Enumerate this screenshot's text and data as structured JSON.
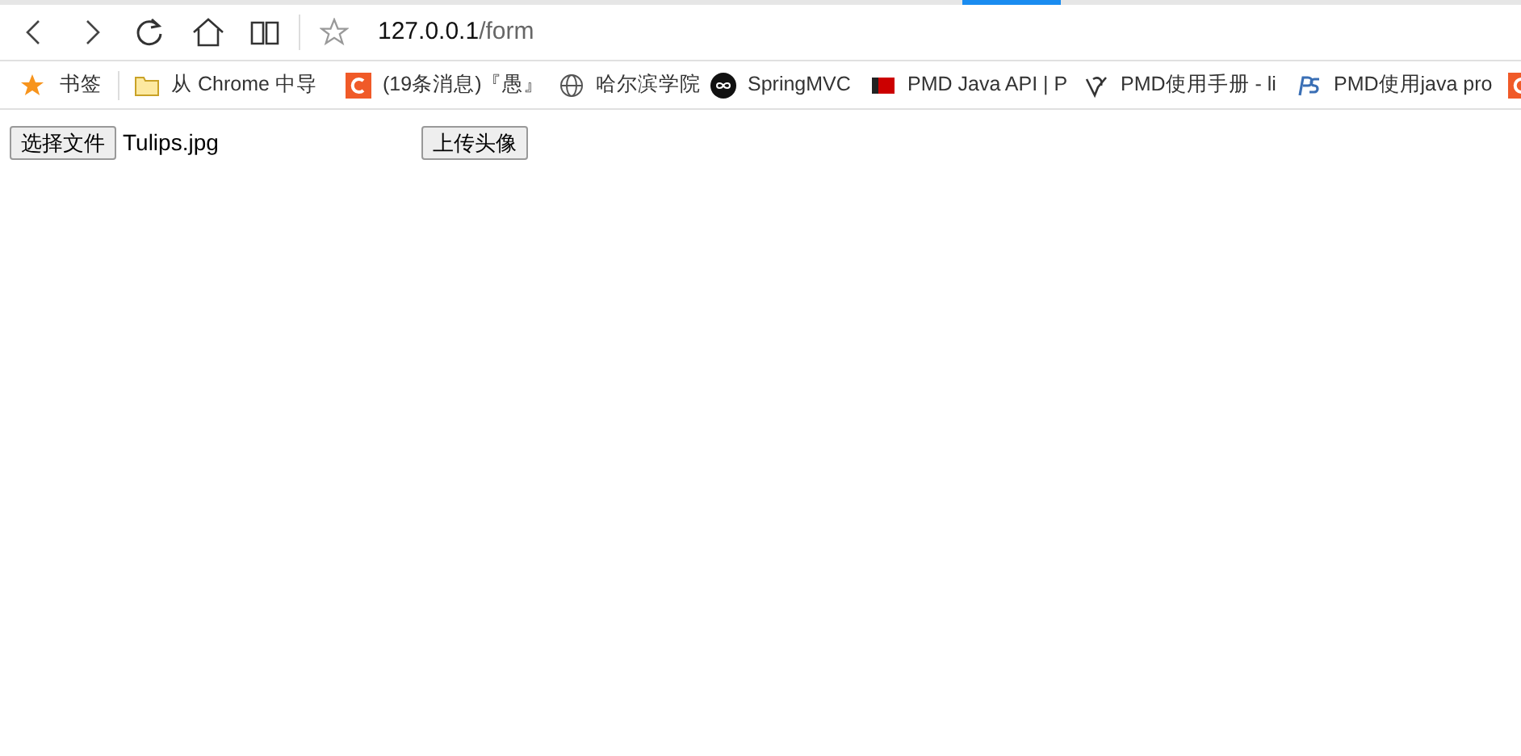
{
  "address_bar": {
    "host": "127.0.0.1",
    "path": "/form"
  },
  "bookmarks": [
    {
      "kind": "star",
      "label": "书签"
    },
    {
      "kind": "folder",
      "label": "从 Chrome 中导"
    },
    {
      "kind": "csdn",
      "label": "(19条消息)『愚』"
    },
    {
      "kind": "globe",
      "label": "哈尔滨学院"
    },
    {
      "kind": "infinity",
      "label": "SpringMVC"
    },
    {
      "kind": "pmd",
      "label": "PMD Java API | P"
    },
    {
      "kind": "sketch",
      "label": "PMD使用手册 - li"
    },
    {
      "kind": "ps",
      "label": "PMD使用java pro"
    },
    {
      "kind": "csdn"
    }
  ],
  "form": {
    "file_button": "选择文件",
    "file_name": "Tulips.jpg",
    "submit_button": "上传头像"
  }
}
